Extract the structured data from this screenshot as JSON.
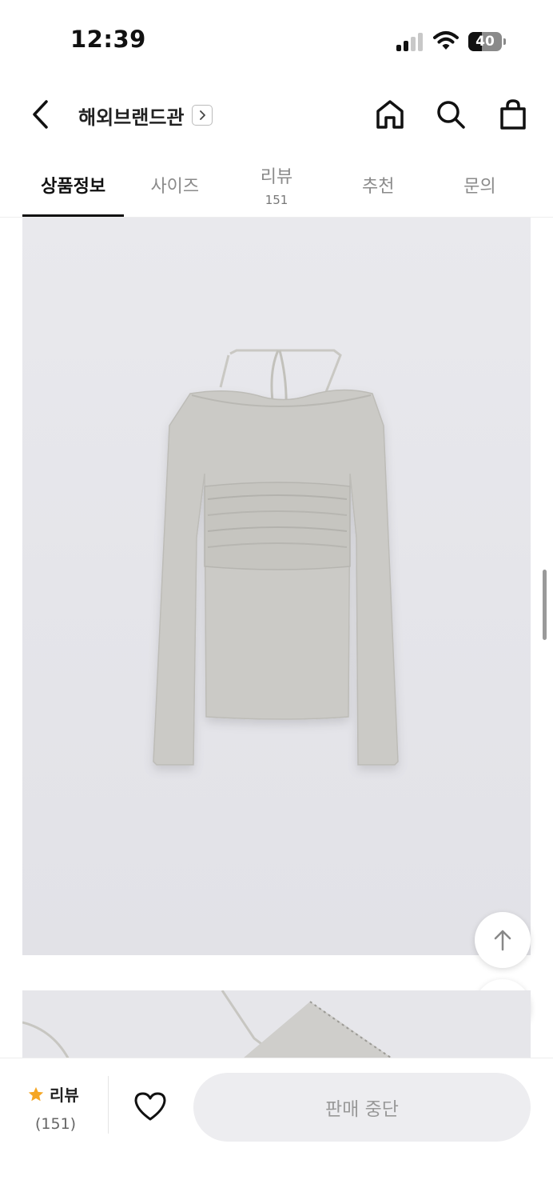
{
  "status_bar": {
    "time": "12:39",
    "battery": "40",
    "battery_level": 0.4
  },
  "header": {
    "brand_title": "해외브랜드관",
    "icons": [
      "back-icon",
      "chevron-right-icon",
      "home-icon",
      "search-icon",
      "shopping-bag-icon"
    ]
  },
  "tabs": [
    {
      "label": "상품정보",
      "active": true
    },
    {
      "label": "사이즈"
    },
    {
      "label": "리뷰",
      "count": "151"
    },
    {
      "label": "추천"
    },
    {
      "label": "문의"
    }
  ],
  "floating": {
    "icons": [
      "arrow-up-icon",
      "arrow-down-icon"
    ]
  },
  "bottom_bar": {
    "review_label": "리뷰",
    "review_count": "(151)",
    "buy_button_label": "판매 중단",
    "star_color": "#F5A623"
  },
  "colors": {
    "active_tab": "#111111",
    "disabled_button": "#EDEDF0"
  }
}
